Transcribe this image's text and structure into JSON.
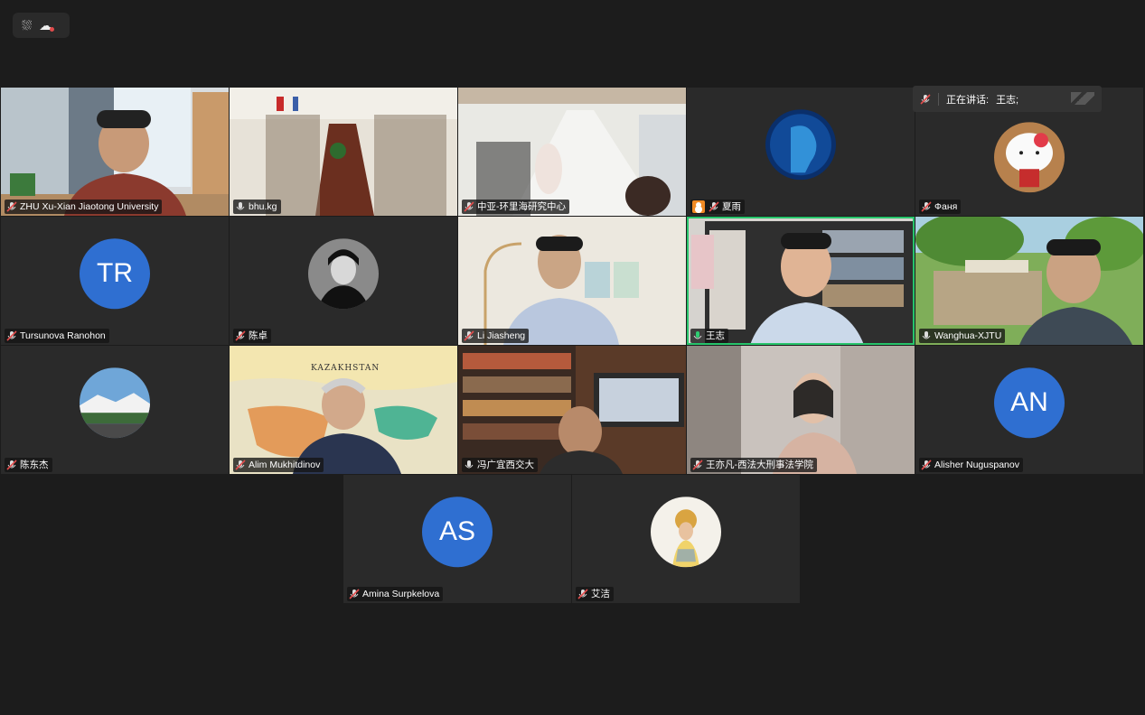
{
  "speaker": {
    "label": "正在讲话:",
    "name": "王志;"
  },
  "participants": [
    {
      "id": "p1",
      "name": "ZHU Xu-Xian Jiaotong University",
      "mic": "muted"
    },
    {
      "id": "p2",
      "name": "bhu.kg",
      "mic": "on"
    },
    {
      "id": "p3",
      "name": "中亚-环里海研究中心",
      "mic": "muted"
    },
    {
      "id": "p4",
      "name": "夏雨",
      "mic": "muted",
      "host": true
    },
    {
      "id": "p5",
      "name": "Фаня",
      "mic": "muted"
    },
    {
      "id": "p6",
      "name": "Tursunova Ranohon",
      "mic": "muted",
      "initials": "TR"
    },
    {
      "id": "p7",
      "name": "陈卓",
      "mic": "muted"
    },
    {
      "id": "p8",
      "name": "Li Jiasheng",
      "mic": "muted"
    },
    {
      "id": "p9",
      "name": "王志",
      "mic": "speaking",
      "active": true
    },
    {
      "id": "p10",
      "name": "Wanghua-XJTU",
      "mic": "on"
    },
    {
      "id": "p11",
      "name": "陈东杰",
      "mic": "muted"
    },
    {
      "id": "p12",
      "name": "Alim Mukhitdinov",
      "mic": "muted",
      "map_text": "KAZAKHSTAN"
    },
    {
      "id": "p13",
      "name": "冯广宜西交大",
      "mic": "on"
    },
    {
      "id": "p14",
      "name": "王亦凡-西法大刑事法学院",
      "mic": "muted"
    },
    {
      "id": "p15",
      "name": "Alisher Nuguspanov",
      "mic": "muted",
      "initials": "AN"
    },
    {
      "id": "p16",
      "name": "Amina Surpkelova",
      "mic": "muted",
      "initials": "AS"
    },
    {
      "id": "p17",
      "name": "艾洁",
      "mic": "muted"
    }
  ]
}
